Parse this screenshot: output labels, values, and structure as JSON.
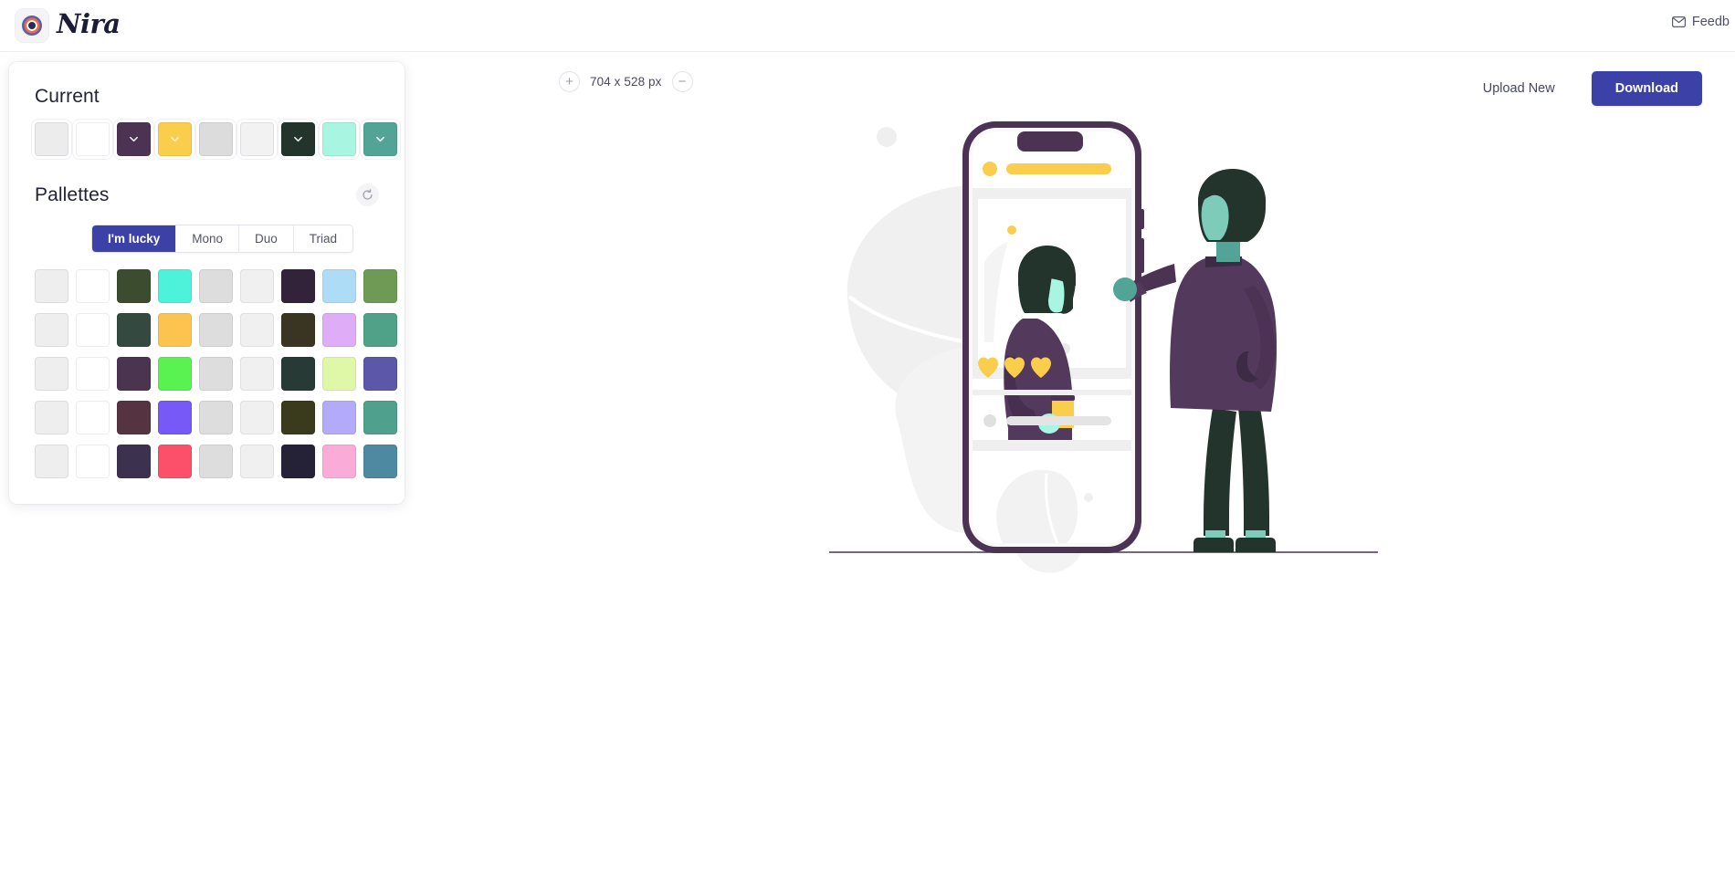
{
  "brand": {
    "name": "Nira",
    "logo_icon": "target-circle-icon"
  },
  "header": {
    "feedback_label": "Feedb",
    "feedback_icon": "envelope-icon"
  },
  "toolbar": {
    "zoom_in_label": "+",
    "zoom_out_label": "−",
    "dimensions": "704 x 528 px",
    "upload_label": "Upload New",
    "download_label": "Download",
    "accent_color": "#3c41a8"
  },
  "panel": {
    "current_title": "Current",
    "palettes_title": "Pallettes",
    "refresh_icon": "refresh-icon",
    "tabs": [
      {
        "label": "I'm lucky",
        "active": true
      },
      {
        "label": "Mono",
        "active": false
      },
      {
        "label": "Duo",
        "active": false
      },
      {
        "label": "Triad",
        "active": false
      }
    ],
    "current_swatches": [
      {
        "color": "#ececec",
        "has_chevron": false
      },
      {
        "color": "#ffffff",
        "has_chevron": false
      },
      {
        "color": "#4c3354",
        "has_chevron": true
      },
      {
        "color": "#fbcd4d",
        "has_chevron": true
      },
      {
        "color": "#dcdcdc",
        "has_chevron": false
      },
      {
        "color": "#f2f2f2",
        "has_chevron": false
      },
      {
        "color": "#22342b",
        "has_chevron": true
      },
      {
        "color": "#a8f5e2",
        "has_chevron": false
      },
      {
        "color": "#52a596",
        "has_chevron": true
      }
    ],
    "palettes": [
      [
        "#eeeeee",
        "#ffffff",
        "#3c4d2f",
        "#4cf2da",
        "#dddddd",
        "#f0f0f0",
        "#32223a",
        "#addcf7",
        "#6f9a55"
      ],
      [
        "#eeeeee",
        "#ffffff",
        "#34493f",
        "#fcc44f",
        "#dddddd",
        "#f0f0f0",
        "#3a3522",
        "#dfacf7",
        "#4fa188"
      ],
      [
        "#eeeeee",
        "#ffffff",
        "#4a3450",
        "#59f251",
        "#dddddd",
        "#f0f0f0",
        "#273a35",
        "#dff8a8",
        "#5c57a8"
      ],
      [
        "#eeeeee",
        "#ffffff",
        "#553341",
        "#7659f7",
        "#dddddd",
        "#f0f0f0",
        "#3a3a1c",
        "#b3abf7",
        "#4fa18e"
      ],
      [
        "#eeeeee",
        "#ffffff",
        "#3c3250",
        "#fb4f6a",
        "#dddddd",
        "#f0f0f0",
        "#252238",
        "#fbabd8",
        "#4d8aa1"
      ]
    ]
  },
  "illustration": {
    "name": "phone-and-person-illustration",
    "colors": {
      "phone_frame": "#4c3354",
      "phone_screen": "#ffffff",
      "screen_bg": "#efefef",
      "accent_yellow": "#fbcd4d",
      "hair_dark": "#22342b",
      "skin_mint": "#a8f5e2",
      "skin_teal": "#52a596",
      "coat_purple": "#533a5c",
      "pants_dark": "#22342b",
      "blob_gray": "#eeeeee",
      "ground_line": "#4c3354"
    }
  }
}
